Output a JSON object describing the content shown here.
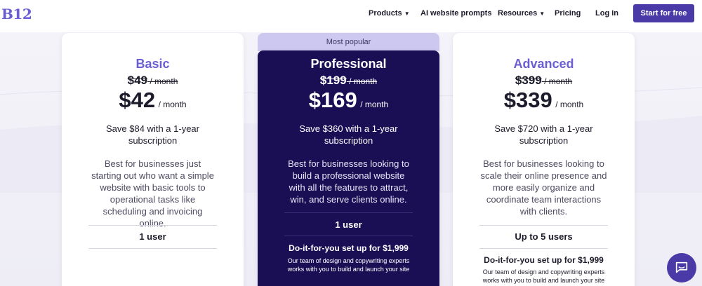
{
  "nav": {
    "logo": "B12",
    "items": [
      {
        "label": "Products",
        "dropdown": true
      },
      {
        "label": "AI website prompts",
        "dropdown": false
      },
      {
        "label": "Resources",
        "dropdown": true
      },
      {
        "label": "Pricing",
        "dropdown": false
      },
      {
        "label": "Log in",
        "dropdown": false
      }
    ],
    "cta": "Start for free"
  },
  "plans": [
    {
      "name": "Basic",
      "old_price": "$49",
      "old_per": "/ month",
      "price": "$42",
      "per": "/ month",
      "save": "Save $84 with a 1-year subscription",
      "description": "Best for businesses just starting out who want a simple website with basic tools to operational tasks like scheduling and invoicing online.",
      "users": "1 user"
    },
    {
      "badge": "Most popular",
      "name": "Professional",
      "old_price": "$199",
      "old_per": "/ month",
      "price": "$169",
      "per": "/ month",
      "save": "Save $360 with a 1-year subscription",
      "description": "Best for businesses looking to build a professional website with all the features to attract, win, and serve clients online.",
      "users": "1 user",
      "diy_title": "Do-it-for-you set up for $1,999",
      "diy_text": "Our team of design and copywriting experts works with you to build and launch your site"
    },
    {
      "name": "Advanced",
      "old_price": "$399",
      "old_per": "/ month",
      "price": "$339",
      "per": "/ month",
      "save": "Save $720 with a 1-year subscription",
      "description": "Best for businesses looking to scale their online presence and more easily organize and coordinate team interactions with clients.",
      "users": "Up to 5 users",
      "diy_title": "Do-it-for-you set up for $1,999",
      "diy_text": "Our team of design and copywriting experts works with you to build and launch your site"
    }
  ],
  "colors": {
    "accent": "#4a3aa8",
    "plan_name": "#6b5dd3",
    "pro_bg": "#1a0f55",
    "badge_bg": "#cdc8ef"
  },
  "chat_icon": "chat-bubble-icon"
}
